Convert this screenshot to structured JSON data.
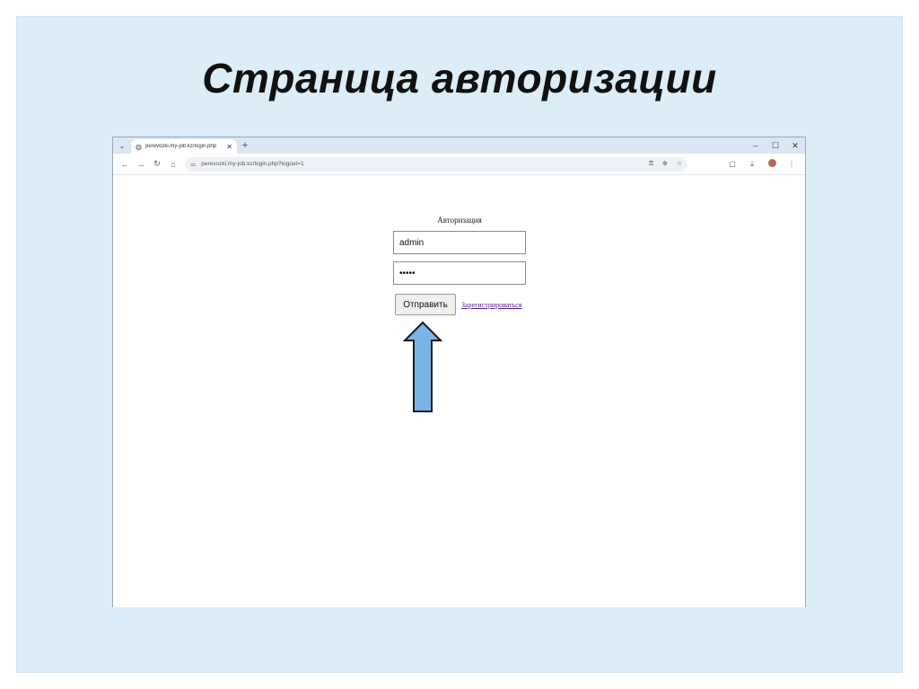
{
  "slide": {
    "title": "Страница авторизации",
    "background": "#dcedf7"
  },
  "browser": {
    "tab_title": "perevozki.my-job.kz/login.php",
    "url": "perevozki.my-job.kz/login.php?logout=1",
    "icons": {
      "tab_menu": "chevron-down-icon",
      "tab_favicon": "globe-icon",
      "tab_close": "close-icon",
      "new_tab": "plus-icon",
      "minimize": "minimize-icon",
      "maximize": "maximize-icon",
      "close_window": "close-icon",
      "back": "arrow-left-icon",
      "forward": "arrow-right-icon",
      "reload": "reload-icon",
      "home": "home-icon",
      "site_info": "tune-icon",
      "password_key": "key-icon",
      "zoom": "zoom-icon",
      "bookmark": "star-icon",
      "extensions": "puzzle-icon",
      "download": "download-icon",
      "profile": "avatar-icon",
      "menu": "kebab-menu-icon"
    }
  },
  "form": {
    "caption": "Авторизация",
    "login_value": "admin",
    "password_value": "•••••",
    "submit_label": "Отправить",
    "register_link": "Зарегистрироваться"
  },
  "annotation": {
    "arrow_color": "#79b4e6",
    "arrow_icon": "arrow-up-icon"
  }
}
